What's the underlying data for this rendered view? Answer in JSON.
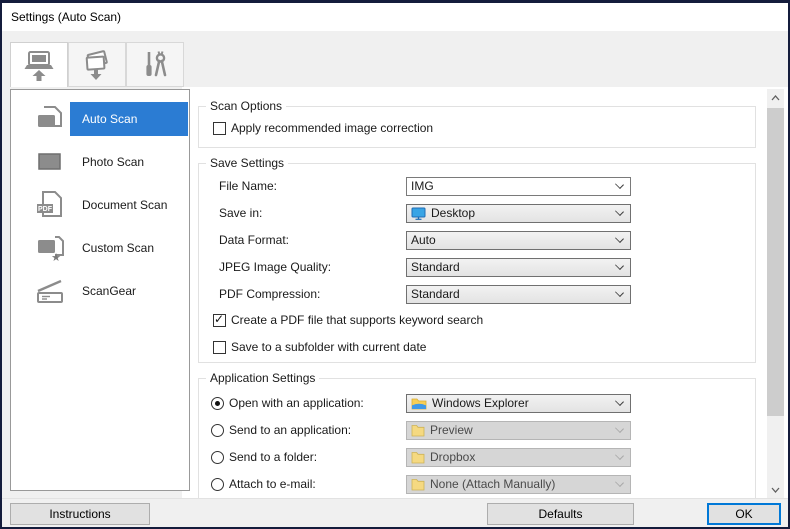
{
  "window": {
    "title": "Settings (Auto Scan)"
  },
  "tabs": [
    {
      "icon": "scan-to-computer-icon",
      "selected": true
    },
    {
      "icon": "scan-document-output-icon",
      "selected": false
    },
    {
      "icon": "tools-icon",
      "selected": false
    }
  ],
  "sidebar": {
    "items": [
      {
        "label": "Auto Scan",
        "icon": "auto-scan-icon",
        "selected": true
      },
      {
        "label": "Photo Scan",
        "icon": "photo-scan-icon",
        "selected": false
      },
      {
        "label": "Document Scan",
        "icon": "document-scan-icon",
        "selected": false
      },
      {
        "label": "Custom Scan",
        "icon": "custom-scan-icon",
        "selected": false
      },
      {
        "label": "ScanGear",
        "icon": "scangear-icon",
        "selected": false
      }
    ]
  },
  "scan_options": {
    "title": "Scan Options",
    "apply_correction": {
      "label": "Apply recommended image correction",
      "checked": false
    }
  },
  "save_settings": {
    "title": "Save Settings",
    "fields": [
      {
        "label": "File Name:",
        "value": "IMG"
      },
      {
        "label": "Save in:",
        "value": "Desktop",
        "icon": "desktop-icon"
      },
      {
        "label": "Data Format:",
        "value": "Auto"
      },
      {
        "label": "JPEG Image Quality:",
        "value": "Standard"
      },
      {
        "label": "PDF Compression:",
        "value": "Standard"
      }
    ],
    "checkboxes": [
      {
        "label": "Create a PDF file that supports keyword search",
        "checked": true
      },
      {
        "label": "Save to a subfolder with current date",
        "checked": false
      }
    ]
  },
  "application_settings": {
    "title": "Application Settings",
    "options": [
      {
        "label": "Open with an application:",
        "value": "Windows Explorer",
        "icon": "windows-explorer-icon",
        "selected": true,
        "disabled": false
      },
      {
        "label": "Send to an application:",
        "value": "Preview",
        "icon": "folder-icon",
        "selected": false,
        "disabled": true
      },
      {
        "label": "Send to a folder:",
        "value": "Dropbox",
        "icon": "folder-icon",
        "selected": false,
        "disabled": true
      },
      {
        "label": "Attach to e-mail:",
        "value": "None (Attach Manually)",
        "icon": "folder-icon",
        "selected": false,
        "disabled": true
      }
    ]
  },
  "footer": {
    "instructions_label": "Instructions",
    "defaults_label": "Defaults",
    "ok_label": "OK"
  },
  "colors": {
    "selection_blue": "#2b7cd3",
    "ok_focus_border": "#0078d7",
    "window_border": "#141c3c",
    "client_bg": "#f0f0f0"
  }
}
